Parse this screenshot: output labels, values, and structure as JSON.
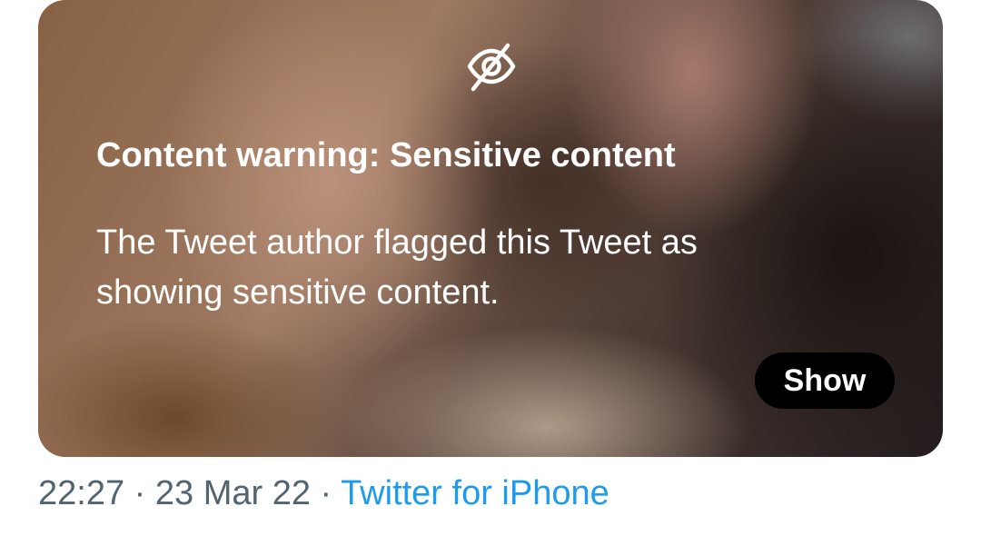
{
  "media": {
    "icon": "eye-slash-icon",
    "warning_title": "Content warning: Sensitive content",
    "warning_body": "The Tweet author flagged this Tweet as showing sensitive content.",
    "show_label": "Show"
  },
  "meta": {
    "time": "22:27",
    "separator1": " · ",
    "date": "23 Mar 22",
    "separator2": " · ",
    "source": "Twitter for iPhone"
  },
  "colors": {
    "meta_text": "#536471",
    "link": "#1d9bf0",
    "button_bg": "#000000",
    "button_text": "#ffffff"
  }
}
